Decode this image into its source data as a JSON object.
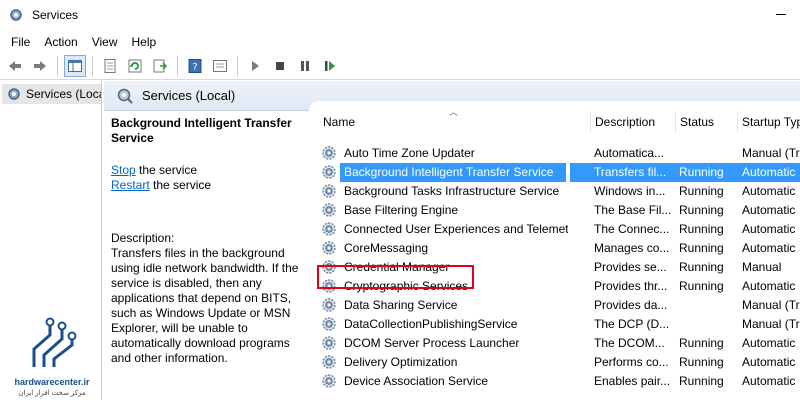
{
  "window": {
    "title": "Services"
  },
  "menu": [
    "File",
    "Action",
    "View",
    "Help"
  ],
  "tree": {
    "item_label": "Services (Local)"
  },
  "panel": {
    "header_title": "Services (Local)"
  },
  "details": {
    "service_title": "Background Intelligent Transfer Service",
    "stop_link": "Stop",
    "stop_suffix": " the service",
    "restart_link": "Restart",
    "restart_suffix": " the service",
    "description_label": "Description:",
    "description_text": "Transfers files in the background using idle network bandwidth. If the service is disabled, then any applications that depend on BITS, such as Windows Update or MSN Explorer, will be unable to automatically download programs and other information."
  },
  "columns": {
    "name": "Name",
    "description": "Description",
    "status": "Status",
    "startup": "Startup Type"
  },
  "rows": [
    {
      "name": "Auto Time Zone Updater",
      "description": "Automatica...",
      "status": "",
      "startup": "Manual (Tr"
    },
    {
      "name": "Background Intelligent Transfer Service",
      "description": "Transfers fil...",
      "status": "Running",
      "startup": "Automatic"
    },
    {
      "name": "Background Tasks Infrastructure Service",
      "description": "Windows in...",
      "status": "Running",
      "startup": "Automatic"
    },
    {
      "name": "Base Filtering Engine",
      "description": "The Base Fil...",
      "status": "Running",
      "startup": "Automatic"
    },
    {
      "name": "Connected User Experiences and Telemetry",
      "description": "The Connec...",
      "status": "Running",
      "startup": "Automatic"
    },
    {
      "name": "CoreMessaging",
      "description": "Manages co...",
      "status": "Running",
      "startup": "Automatic"
    },
    {
      "name": "Credential Manager",
      "description": "Provides se...",
      "status": "Running",
      "startup": "Manual"
    },
    {
      "name": "Cryptographic Services",
      "description": "Provides thr...",
      "status": "Running",
      "startup": "Automatic"
    },
    {
      "name": "Data Sharing Service",
      "description": "Provides da...",
      "status": "",
      "startup": "Manual (Tr"
    },
    {
      "name": "DataCollectionPublishingService",
      "description": "The DCP (D...",
      "status": "",
      "startup": "Manual (Tr"
    },
    {
      "name": "DCOM Server Process Launcher",
      "description": "The DCOM...",
      "status": "Running",
      "startup": "Automatic"
    },
    {
      "name": "Delivery Optimization",
      "description": "Performs co...",
      "status": "Running",
      "startup": "Automatic"
    },
    {
      "name": "Device Association Service",
      "description": "Enables pair...",
      "status": "Running",
      "startup": "Automatic"
    }
  ],
  "selected_index": 1,
  "highlighted_index": 7,
  "watermark": {
    "site": "hardwarecenter.ir",
    "tagline": "مرکز سخت افزار ایران"
  },
  "colors": {
    "selection": "#3399ff",
    "highlight_box": "#e3001b",
    "link": "#0066cc"
  }
}
